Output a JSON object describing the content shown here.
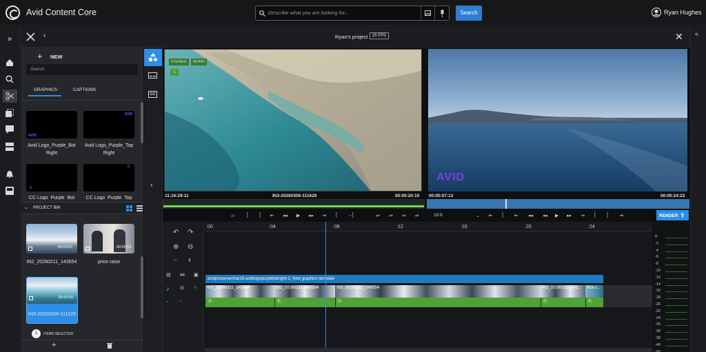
{
  "app": {
    "title": "Avid Content Core"
  },
  "search": {
    "placeholder": "Describe what you are looking for...",
    "button": "Search"
  },
  "user": {
    "name": "Ryan Hughes"
  },
  "project": {
    "name": "Ryan's project",
    "fps": "25 FPS"
  },
  "library": {
    "new_label": "NEW",
    "search_placeholder": "Search",
    "tabs": [
      {
        "label": "GRAPHICS",
        "active": true
      },
      {
        "label": "CAPTIONS",
        "active": false
      }
    ],
    "graphics": [
      {
        "name": "Avid Logo_Purple_Bot Right",
        "mark": "AVID"
      },
      {
        "name": "Avid Logo_Purple_Top Right",
        "mark": "AVID"
      },
      {
        "name": "CC Logo_Purple_Bot",
        "mark": "C"
      },
      {
        "name": "CC Logo_Purple_Top",
        "mark": "C"
      }
    ],
    "bin_title": "PROJECT BIN",
    "bin_items": [
      {
        "name": "IN2_20260211_143554",
        "duration": "00:03:01"
      },
      {
        "name": "price raise",
        "duration": "00:00:10"
      },
      {
        "name": "IN3-20260306-111629",
        "duration": "00:00:20",
        "selected": true
      }
    ],
    "selected_count": "1",
    "selected_label": "ITEMS SELECTED"
  },
  "side_tabs": [
    "CC"
  ],
  "source": {
    "badges": [
      "STEREO",
      "MONO"
    ],
    "track": "1",
    "tc_left": "11:16:29:11",
    "clip": "IN3-20260306-111629",
    "tc_right": "00:00:20:10",
    "progress": 1.0
  },
  "record": {
    "tc_left": "00:00:07:13",
    "tc_right": "00:00:24:23",
    "aspect": "16:9",
    "render": "RENDER",
    "playhead": 0.3,
    "logo": "AVID"
  },
  "timeline": {
    "ruler": [
      ":00",
      ":04",
      ":08",
      ":12",
      ":16",
      ":20",
      ":24"
    ],
    "graphics_clip": "avidproservermar19-avidlogopurplebotright-1: New graphics template",
    "clips": [
      "IN2_20260211_143554",
      "IN2_20260211_143554",
      "IN2_20260211_143554",
      "IN2_20260211_143...",
      "IN3-2..."
    ],
    "track_num": "1"
  },
  "meter": {
    "labels": [
      "0",
      "-2",
      "-4",
      "-6",
      "-8",
      "-10",
      "-12",
      "-14",
      "-16",
      "-18",
      "-20",
      "-22",
      "-24",
      "-26",
      "-28",
      "-30",
      "-40",
      "-60"
    ]
  }
}
